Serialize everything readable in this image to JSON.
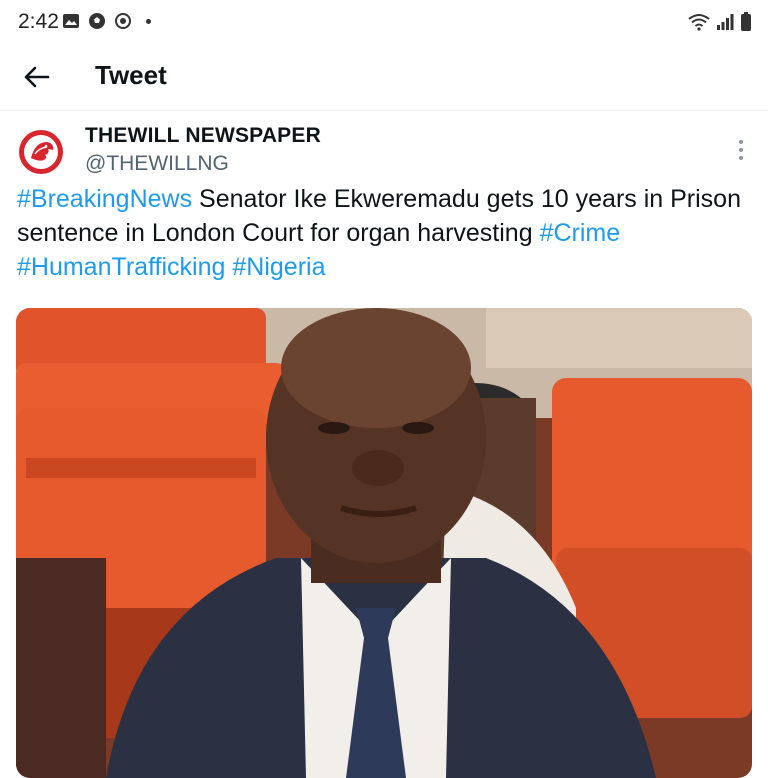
{
  "status_bar": {
    "time": "2:42",
    "left_icons": [
      "gallery-icon",
      "soccer-ball-icon",
      "whatsapp-icon"
    ],
    "right_icons": [
      "wifi-icon",
      "signal-icon",
      "battery-icon"
    ]
  },
  "header": {
    "title": "Tweet"
  },
  "tweet": {
    "author_name": "THEWILL NEWSPAPER",
    "author_handle": "@THEWILLNG",
    "hashtags": {
      "breaking": "#BreakingNews",
      "crime": "#Crime",
      "human_trafficking": "#HumanTrafficking",
      "nigeria": "#Nigeria"
    },
    "text_main": " Senator Ike Ekweremadu gets 10 years in Prison sentence in London Court for organ harvesting ",
    "text_space": " "
  },
  "colors": {
    "link": "#1d9bf0",
    "text": "#0f1419",
    "secondary": "#536471",
    "avatar_red": "#d7262e",
    "seat_orange": "#e2542a"
  }
}
